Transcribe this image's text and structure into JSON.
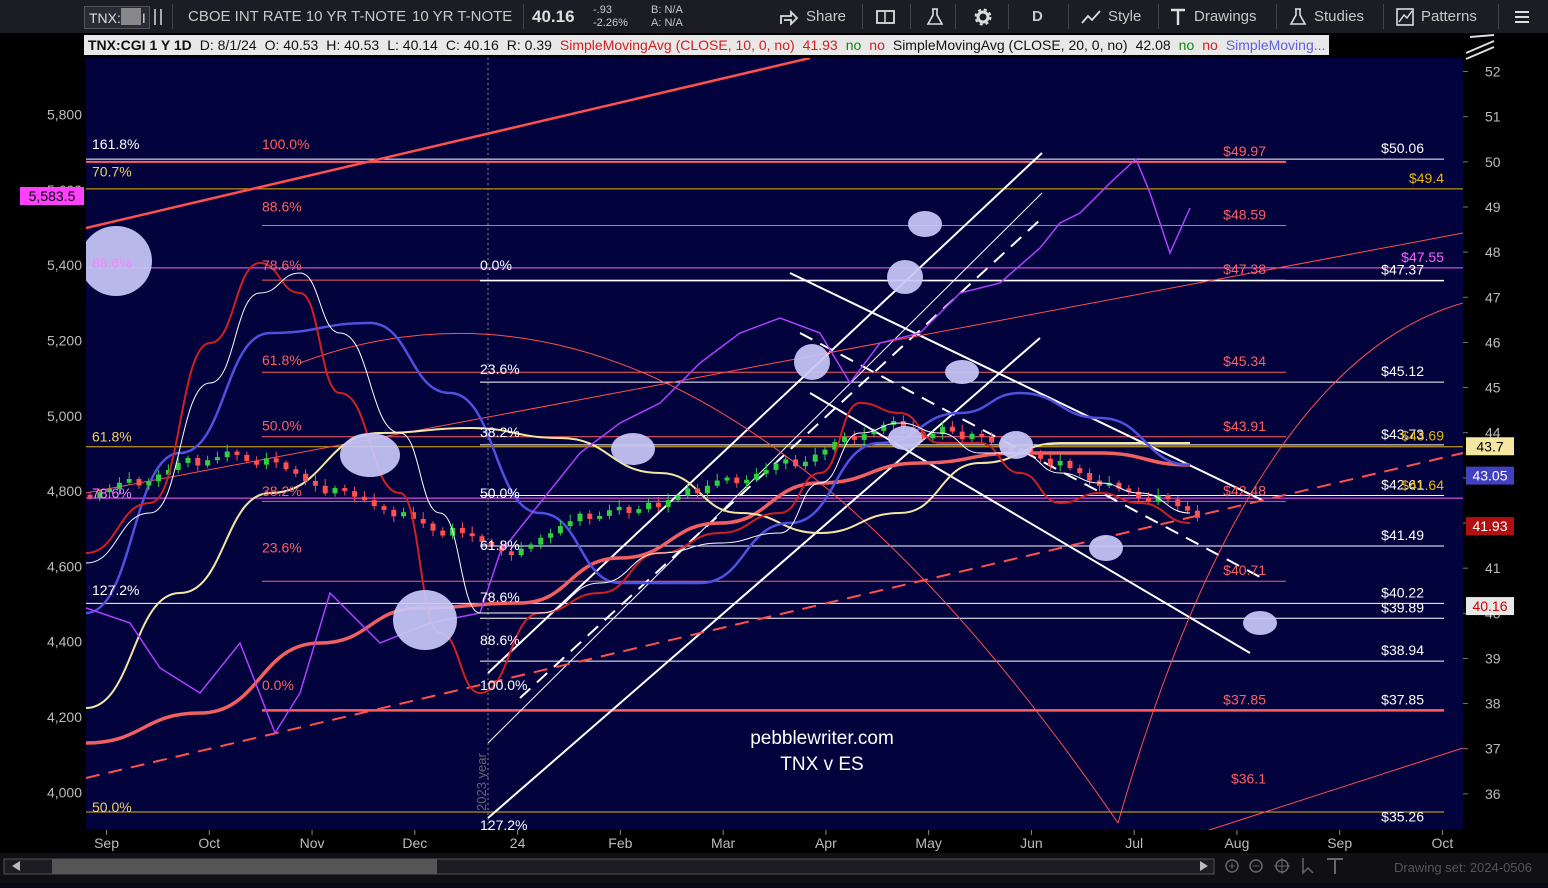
{
  "toolbar": {
    "symbol": "TNX:CGI",
    "desc1": "CBOE INT RATE 10 YR T-NOTE",
    "desc2": "10 YR T-NOTE",
    "price": "40.16",
    "change": "-.93",
    "change_pct": "-2.26%",
    "bid": "B: N/A",
    "ask": "A: N/A",
    "share": "Share",
    "period": "D",
    "style": "Style",
    "drawings": "Drawings",
    "studies": "Studies",
    "patterns": "Patterns"
  },
  "infobar": {
    "title": "TNX:CGI 1 Y 1D",
    "date": "D: 8/1/24",
    "open": "O: 40.53",
    "high": "H: 40.53",
    "low": "L: 40.14",
    "close": "C: 40.16",
    "range": "R: 0.39",
    "sma10": "SimpleMovingAvg (CLOSE, 10, 0, no)",
    "sma10_val": "41.93",
    "sma20": "SimpleMovingAvg (CLOSE, 20, 0, no)",
    "sma20_val": "42.08",
    "no": "no",
    "sma_more": "SimpleMoving..."
  },
  "chart_data": {
    "type": "line",
    "x_ticks": [
      "Sep",
      "Oct",
      "Nov",
      "Dec",
      "24",
      "Feb",
      "Mar",
      "Apr",
      "May",
      "Jun",
      "Jul",
      "Aug",
      "Sep",
      "Oct"
    ],
    "right_axis": [
      "52",
      "51",
      "50",
      "49",
      "48",
      "47",
      "46",
      "45",
      "44",
      "43",
      "42",
      "41",
      "40",
      "39",
      "38",
      "37",
      "36"
    ],
    "left_axis": [
      "5,800",
      "5,600",
      "5,400",
      "5,200",
      "5,000",
      "4,800",
      "4,600",
      "4,400",
      "4,200",
      "4,000"
    ],
    "ylim_right": [
      35.2,
      52.3
    ],
    "ylim_left": [
      3900,
      5950
    ],
    "badges": [
      {
        "label": "43.7",
        "value": 43.7,
        "color": "#f5e6a0",
        "text": "#000"
      },
      {
        "label": "43.05",
        "value": 43.05,
        "color": "#4040c0",
        "text": "#fff"
      },
      {
        "label": "41.93",
        "value": 41.93,
        "color": "#b01010",
        "text": "#fff"
      },
      {
        "label": "40.16",
        "value": 40.16,
        "color": "#e8e8e8",
        "text": "#c00"
      }
    ],
    "left_badge": {
      "label": "5,583.5",
      "value": 5583.5
    },
    "fib_labels_red": [
      {
        "label": "$49.97",
        "value": 50.0
      },
      {
        "label": "$48.59",
        "value": 48.59
      },
      {
        "label": "$47.38",
        "value": 47.38
      },
      {
        "label": "$45.34",
        "value": 45.34
      },
      {
        "label": "$43.91",
        "value": 43.91
      },
      {
        "label": "$42.48",
        "value": 42.48
      },
      {
        "label": "$40.71",
        "value": 40.71
      },
      {
        "label": "$37.85",
        "value": 37.85
      },
      {
        "label": "$36.1",
        "value": 36.1
      }
    ],
    "fib_labels_white": [
      {
        "label": "$50.06",
        "value": 50.06
      },
      {
        "label": "$47.37",
        "value": 47.37
      },
      {
        "label": "$45.12",
        "value": 45.12
      },
      {
        "label": "$43.73",
        "value": 43.73
      },
      {
        "label": "$42.61",
        "value": 42.61
      },
      {
        "label": "$41.49",
        "value": 41.49
      },
      {
        "label": "$40.22",
        "value": 40.22
      },
      {
        "label": "$39.89",
        "value": 39.89
      },
      {
        "label": "$38.94",
        "value": 38.94
      },
      {
        "label": "$37.85",
        "value": 37.85
      },
      {
        "label": "$35.26",
        "value": 35.26
      }
    ],
    "fib_labels_yellow": [
      {
        "label": "$49.4",
        "value": 49.4
      },
      {
        "label": "$43.69",
        "value": 43.69
      },
      {
        "label": "$41.64",
        "value": 42.6
      }
    ],
    "fib_labels_pink": [
      {
        "label": "$47.55",
        "value": 47.65
      }
    ],
    "pct_labels": [
      {
        "label": "161.8%",
        "value": 50.28,
        "col": "left",
        "color": "#ffffff"
      },
      {
        "label": "70.7%",
        "value": 49.67,
        "col": "left",
        "color": "#f0d060"
      },
      {
        "label": "88.6%",
        "value": 47.65,
        "col": "left",
        "color": "#ff80ff"
      },
      {
        "label": "61.8%",
        "value": 43.8,
        "col": "left",
        "color": "#f0d060"
      },
      {
        "label": "78.6%",
        "value": 42.55,
        "col": "left",
        "color": "#ff80ff"
      },
      {
        "label": "127.2%",
        "value": 40.4,
        "col": "left",
        "color": "#ffffff"
      },
      {
        "label": "50.0%",
        "value": 35.6,
        "col": "left",
        "color": "#f0d060"
      },
      {
        "label": "100.0%",
        "value": 50.28,
        "col": "mid",
        "color": "#ff6060"
      },
      {
        "label": "88.6%",
        "value": 48.9,
        "col": "mid",
        "color": "#ff6060"
      },
      {
        "label": "78.6%",
        "value": 47.6,
        "col": "mid",
        "color": "#ff6060"
      },
      {
        "label": "61.8%",
        "value": 45.5,
        "col": "mid",
        "color": "#ff6060"
      },
      {
        "label": "50.0%",
        "value": 44.05,
        "col": "mid",
        "color": "#ff6060"
      },
      {
        "label": "38.2%",
        "value": 42.6,
        "col": "mid",
        "color": "#ff6060"
      },
      {
        "label": "23.6%",
        "value": 41.35,
        "col": "mid",
        "color": "#ff6060"
      },
      {
        "label": "0.0%",
        "value": 38.3,
        "col": "mid",
        "color": "#ff6060"
      },
      {
        "label": "0.0%",
        "value": 47.6,
        "col": "right",
        "color": "#ffffff"
      },
      {
        "label": "23.6%",
        "value": 45.3,
        "col": "right",
        "color": "#ffffff"
      },
      {
        "label": "38.2%",
        "value": 43.9,
        "col": "right",
        "color": "#ffffff"
      },
      {
        "label": "50.0%",
        "value": 42.55,
        "col": "right",
        "color": "#ffffff"
      },
      {
        "label": "61.8%",
        "value": 41.4,
        "col": "right",
        "color": "#ffffff"
      },
      {
        "label": "78.6%",
        "value": 40.25,
        "col": "right",
        "color": "#ffffff"
      },
      {
        "label": "88.6%",
        "value": 39.3,
        "col": "right",
        "color": "#ffffff"
      },
      {
        "label": "100.0%",
        "value": 38.3,
        "col": "right",
        "color": "#ffffff"
      },
      {
        "label": "127.2%",
        "value": 35.2,
        "col": "right",
        "color": "#ffffff"
      }
    ],
    "watermark": [
      "pebblewriter.com",
      "TNX v ES"
    ],
    "year_label": "2023 year",
    "drawing_set": "Drawing set: 2024-0506",
    "series": [
      {
        "name": "SimpleMovingAvg (CLOSE, 10, 0, no)",
        "color": "#e03030"
      },
      {
        "name": "SimpleMovingAvg (CLOSE, 20, 0, no)",
        "color": "#ffffff"
      }
    ]
  }
}
